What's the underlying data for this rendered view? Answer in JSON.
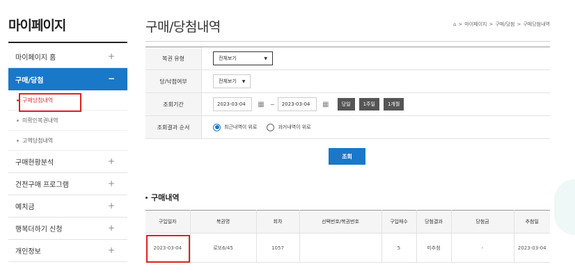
{
  "sidebar": {
    "title": "마이페이지",
    "items": [
      {
        "label": "마이페이지 홈",
        "sign": "+"
      },
      {
        "label": "구매/당첨",
        "sign": "−"
      },
      {
        "label": "구매현황분석",
        "sign": "+"
      },
      {
        "label": "건전구매 프로그램",
        "sign": "+"
      },
      {
        "label": "예치금",
        "sign": "+"
      },
      {
        "label": "행복더하기 신청",
        "sign": "+"
      },
      {
        "label": "개인정보",
        "sign": "+"
      }
    ],
    "subitems": [
      {
        "label": "구매당첨내역"
      },
      {
        "label": "미확인복권내역"
      },
      {
        "label": "고액당첨내역"
      }
    ]
  },
  "header": {
    "title": "구매/당첨내역",
    "breadcrumb": [
      "마이페이지",
      "구매/당첨",
      "구매당첨내역"
    ]
  },
  "filter": {
    "rows": [
      {
        "label": "복권 유형"
      },
      {
        "label": "당/낙첨여부"
      },
      {
        "label": "조회기간"
      },
      {
        "label": "조회결과 순서"
      }
    ],
    "type_select": "전체보기",
    "result_select": "전체보기",
    "date_from": "2023-03-04",
    "date_to": "2023-03-04",
    "quick_buttons": [
      "당일",
      "1주일",
      "1개월"
    ],
    "order_options": [
      "최근내역이 위로",
      "과거내역이 위로"
    ],
    "search_label": "조회"
  },
  "purchases": {
    "title": "구매내역",
    "columns": [
      "구입일자",
      "복권명",
      "회차",
      "선택번호/복권번호",
      "구입매수",
      "당첨결과",
      "당첨금",
      "추첨일"
    ],
    "rows": [
      [
        "2023-03-04",
        "로또6/45",
        "1057",
        "",
        "5",
        "미추첨",
        "-",
        "2023-03-04"
      ]
    ]
  },
  "colors": {
    "accent": "#1a78c8",
    "highlight": "#e02020"
  }
}
